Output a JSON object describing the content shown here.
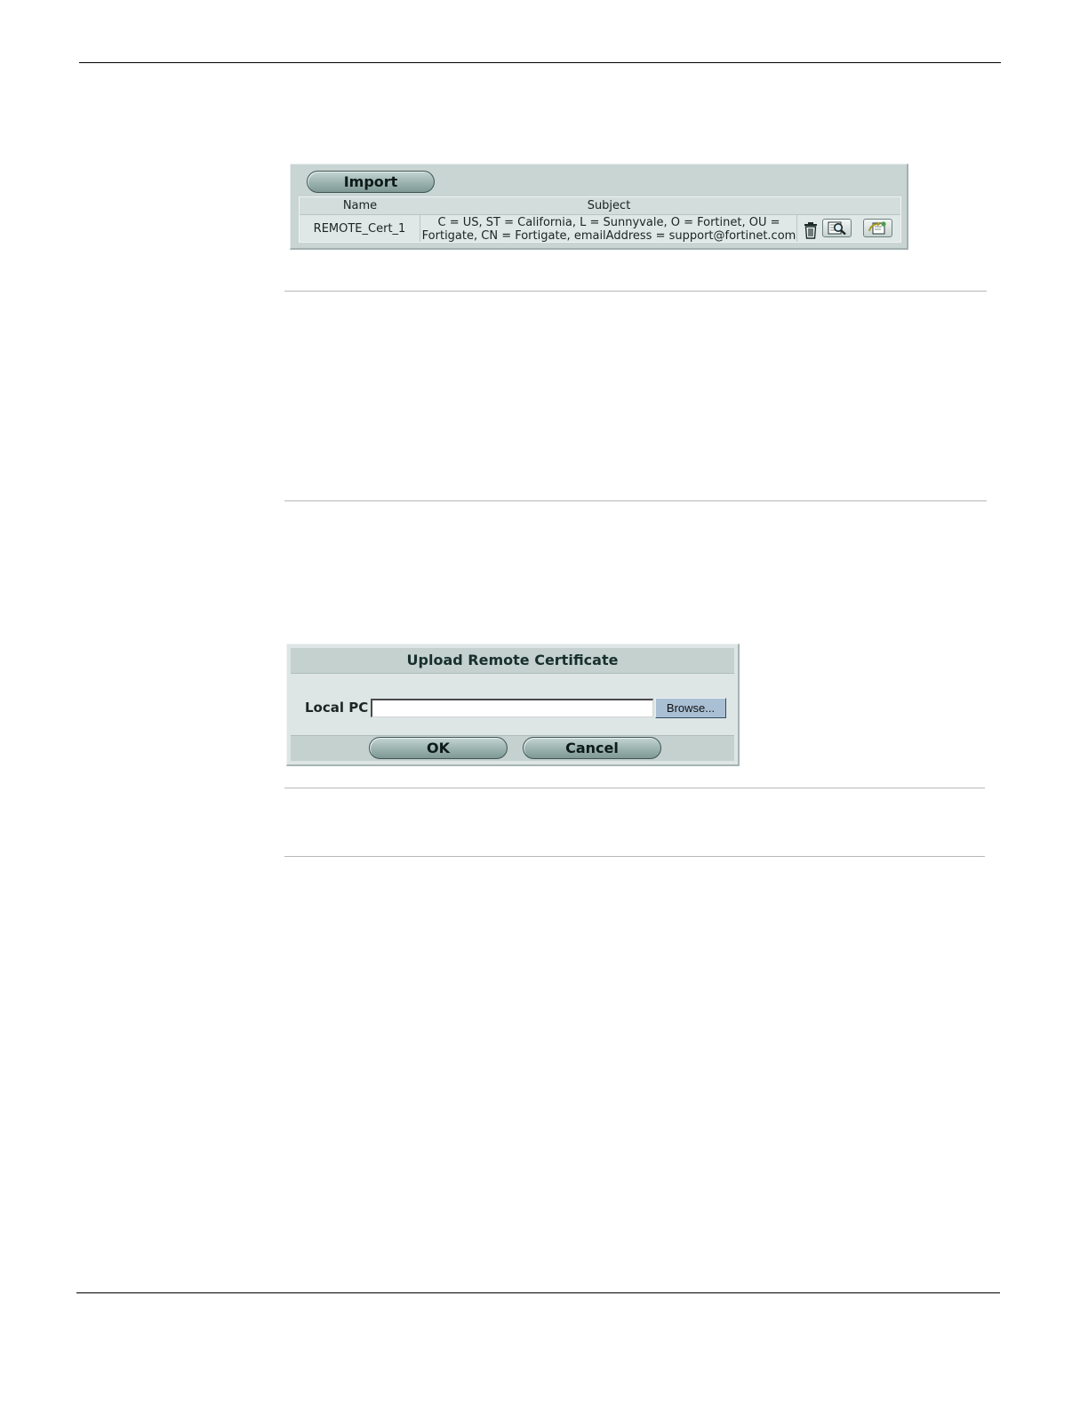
{
  "certificate_list": {
    "import_label": "Import",
    "columns": {
      "name": "Name",
      "subject": "Subject",
      "actions": ""
    },
    "rows": [
      {
        "name": "REMOTE_Cert_1",
        "subject_line1": "C = US, ST = California, L = Sunnyvale, O = Fortinet, OU =",
        "subject_line2": "Fortigate, CN = Fortigate, emailAddress = support@fortinet.com",
        "action_icons": [
          "trash-icon",
          "view-details-icon",
          "download-icon"
        ]
      }
    ]
  },
  "upload_dialog": {
    "title": "Upload Remote Certificate",
    "local_pc_label": "Local PC",
    "file_value": "",
    "browse_label": "Browse...",
    "ok_label": "OK",
    "cancel_label": "Cancel"
  },
  "colors": {
    "panel_background": "#c9d5d3",
    "button_gradient_dark": "#7f9895",
    "browse_button": "#a9bfd3",
    "dialog_header_text": "#17302d"
  }
}
